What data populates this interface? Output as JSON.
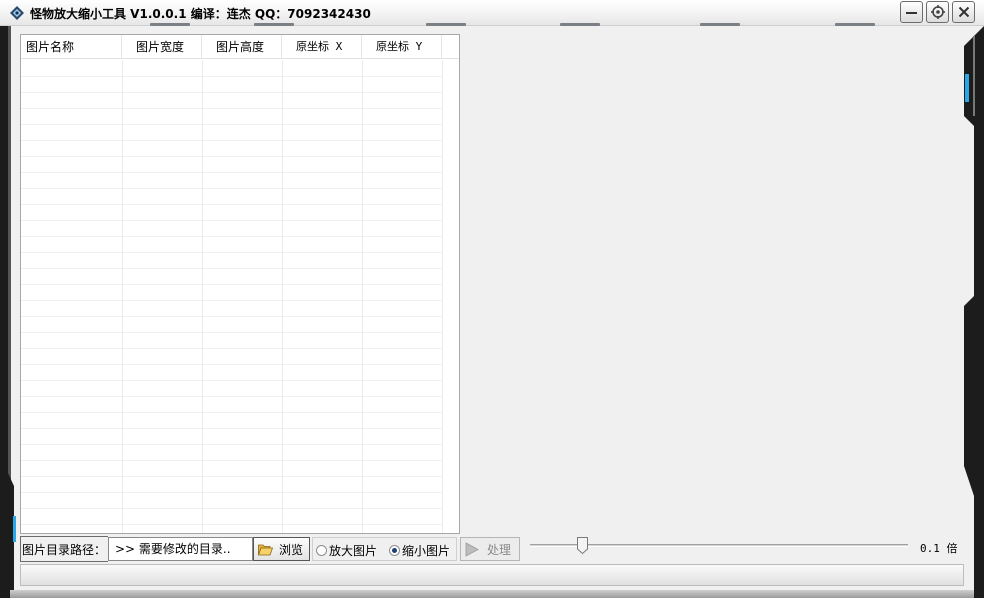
{
  "window": {
    "title": "怪物放大缩小工具 V1.0.0.1  编译：连杰  QQ：7092342430"
  },
  "controls": {
    "minimize_icon": "minimize-icon",
    "settings_icon": "settings-icon",
    "close_icon": "close-icon"
  },
  "list": {
    "columns": [
      {
        "label": "图片名称"
      },
      {
        "label": "图片宽度"
      },
      {
        "label": "图片高度"
      },
      {
        "label": "原坐标 X"
      },
      {
        "label": "原坐标 Y"
      }
    ]
  },
  "toolbar": {
    "path_label": "图片目录路径：",
    "path_value": ">> 需要修改的目录..",
    "browse_label": "浏览",
    "radio_enlarge": "放大图片",
    "radio_shrink": "缩小图片",
    "selected_mode": "缩小图片",
    "process_label": "处理",
    "ratio_text": "0.1 倍",
    "slider_value": 0.1
  },
  "colors": {
    "frame_dark": "#1c1c1c",
    "accent_blue": "#2aa7e6"
  }
}
